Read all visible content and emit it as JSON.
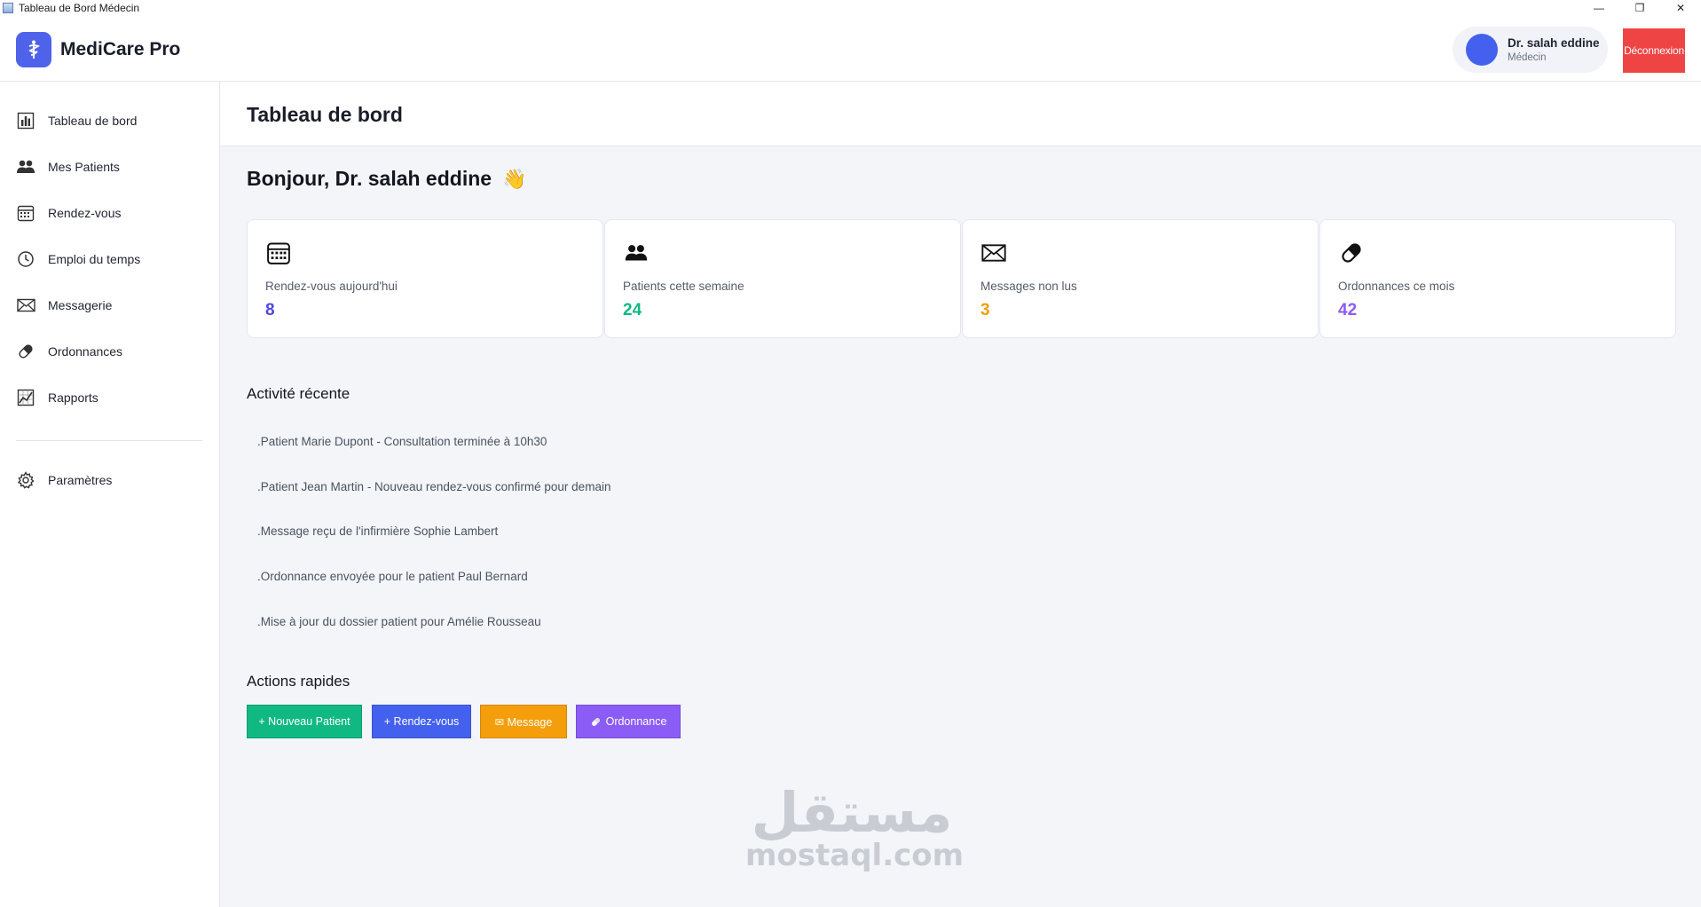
{
  "window": {
    "title": "Tableau de Bord Médecin",
    "minimize": "—",
    "restore": "❐",
    "close": "✕"
  },
  "header": {
    "brand": "MediCare Pro",
    "user_name": "Dr. salah eddine",
    "user_role": "Médecin",
    "logout_label": "Déconnexion"
  },
  "sidebar": {
    "items": [
      {
        "label": "Tableau de bord",
        "icon": "bar-chart-icon"
      },
      {
        "label": "Mes Patients",
        "icon": "users-icon"
      },
      {
        "label": "Rendez-vous",
        "icon": "calendar-icon"
      },
      {
        "label": "Emploi du temps",
        "icon": "clock-icon"
      },
      {
        "label": "Messagerie",
        "icon": "envelope-icon"
      },
      {
        "label": "Ordonnances",
        "icon": "pill-icon"
      },
      {
        "label": "Rapports",
        "icon": "line-chart-icon"
      },
      {
        "label": "Paramètres",
        "icon": "gear-icon"
      }
    ]
  },
  "main": {
    "page_title": "Tableau de bord",
    "greeting": "Bonjour, Dr. salah eddine",
    "greeting_emoji": "👋",
    "stats": [
      {
        "label": "Rendez-vous aujourd'hui",
        "value": "8",
        "color": "#4f46e5",
        "icon": "calendar-icon"
      },
      {
        "label": "Patients cette semaine",
        "value": "24",
        "color": "#10b981",
        "icon": "users-icon"
      },
      {
        "label": "Messages non lus",
        "value": "3",
        "color": "#f59e0b",
        "icon": "envelope-icon"
      },
      {
        "label": "Ordonnances ce mois",
        "value": "42",
        "color": "#8b5cf6",
        "icon": "pill-icon"
      }
    ],
    "activity_title": "Activité récente",
    "activities": [
      ".Patient Marie Dupont - Consultation terminée à 10h30",
      ".Patient Jean Martin - Nouveau rendez-vous confirmé pour demain",
      ".Message reçu de l'infirmière Sophie Lambert",
      ".Ordonnance envoyée pour le patient Paul Bernard",
      ".Mise à jour du dossier patient pour Amélie Rousseau"
    ],
    "quick_title": "Actions rapides",
    "quick_actions": [
      {
        "label": "+ Nouveau Patient",
        "color": "#10b981"
      },
      {
        "label": "+ Rendez-vous",
        "color": "#4361ee"
      },
      {
        "label": "✉ Message",
        "color": "#f59e0b"
      },
      {
        "label": "Ordonnance",
        "color": "#8b5cf6"
      }
    ]
  },
  "watermark": {
    "arabic": "مستقل",
    "latin": "mostaql.com"
  }
}
